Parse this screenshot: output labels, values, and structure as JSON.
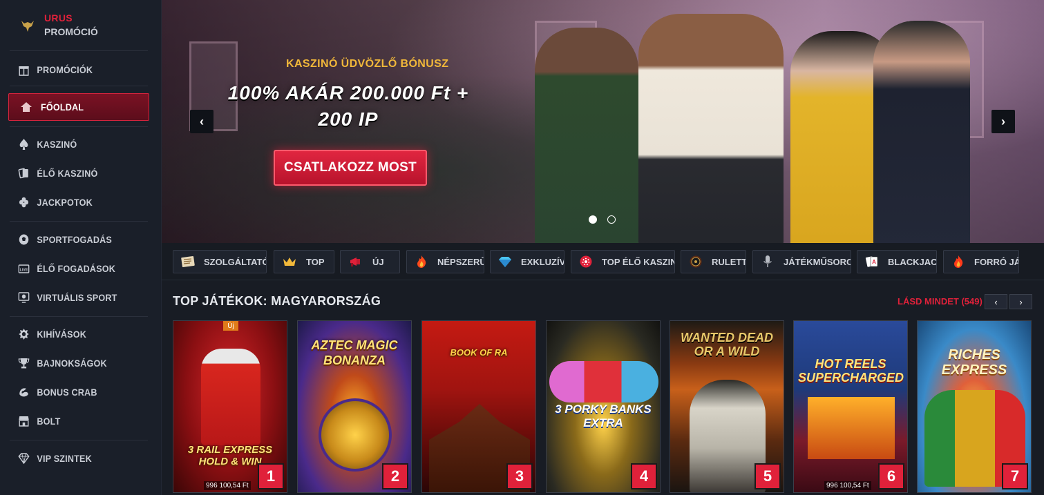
{
  "sidebar": {
    "promo": {
      "line1": "URUS",
      "line2": "PROMÓCIÓ"
    },
    "items": [
      {
        "label": "PROMÓCIÓK",
        "icon": "gift-icon"
      },
      {
        "label": "FŐOLDAL",
        "icon": "home-icon",
        "active": true
      },
      {
        "label": "KASZINÓ",
        "icon": "spade-icon"
      },
      {
        "label": "ÉLŐ KASZINÓ",
        "icon": "live-cards-icon"
      },
      {
        "label": "JACKPOTOK",
        "icon": "clover-icon"
      },
      {
        "label": "SPORTFOGADÁS",
        "icon": "soccer-ball-icon"
      },
      {
        "label": "ÉLŐ FOGADÁSOK",
        "icon": "live-tv-icon"
      },
      {
        "label": "VIRTUÁLIS SPORT",
        "icon": "monitor-ball-icon"
      },
      {
        "label": "KIHÍVÁSOK",
        "icon": "badge-icon"
      },
      {
        "label": "BAJNOKSÁGOK",
        "icon": "trophy-icon"
      },
      {
        "label": "BONUS CRAB",
        "icon": "crab-claw-icon"
      },
      {
        "label": "BOLT",
        "icon": "shop-icon"
      },
      {
        "label": "VIP SZINTEK",
        "icon": "diamond-icon"
      }
    ]
  },
  "banner": {
    "subtitle": "KASZINÓ ÜDVÖZLŐ BÓNUSZ",
    "headline_line1": "100% AKÁR 200.000 Ft +",
    "headline_line2": "200 IP",
    "cta": "CSATLAKOZZ MOST",
    "prev": "‹",
    "next": "›",
    "slides_total": 2,
    "slide_active": 1
  },
  "categories": [
    {
      "label": "SZOLGÁLTATÓK",
      "icon": "provider-icon"
    },
    {
      "label": "TOP",
      "icon": "crown-icon"
    },
    {
      "label": "ÚJ",
      "icon": "megaphone-icon"
    },
    {
      "label": "NÉPSZERŰ",
      "icon": "fire-icon"
    },
    {
      "label": "EXKLUZÍV",
      "icon": "gem-icon"
    },
    {
      "label": "TOP ÉLŐ KASZINÓ",
      "icon": "chip-icon"
    },
    {
      "label": "RULETT",
      "icon": "roulette-icon"
    },
    {
      "label": "JÁTÉKMŰSOROK",
      "icon": "microphone-icon"
    },
    {
      "label": "BLACKJACK",
      "icon": "cards-icon"
    },
    {
      "label": "FORRÓ JÁTÉKOK",
      "icon": "hot-fire-icon"
    }
  ],
  "top_games": {
    "title": "TOP JÁTÉKOK: MAGYARORSZÁG",
    "see_all": "LÁSD MINDET (549)",
    "games": [
      {
        "rank": "1",
        "title": "3 RAIL EXPRESS HOLD & WIN",
        "badge": "Új",
        "price": "996 100,54 Ft",
        "bg": "#7a1010"
      },
      {
        "rank": "2",
        "title": "AZTEC MAGIC BONANZA",
        "badge": "",
        "price": "",
        "bg": "#3a2a7a"
      },
      {
        "rank": "3",
        "title": "BOOK OF RA",
        "badge": "",
        "price": "",
        "bg": "#8a1a10"
      },
      {
        "rank": "4",
        "title": "3 PORKY BANKS EXTRA",
        "badge": "",
        "price": "",
        "bg": "#2a2a2a"
      },
      {
        "rank": "5",
        "title": "WANTED DEAD OR A WILD",
        "badge": "",
        "price": "",
        "bg": "#5a2a14"
      },
      {
        "rank": "6",
        "title": "HOT REELS SUPERCHARGED",
        "badge": "",
        "price": "996 100,54 Ft",
        "bg": "#1e3a7a"
      },
      {
        "rank": "7",
        "title": "RICHES EXPRESS",
        "badge": "",
        "price": "",
        "bg": "#2a7ab0"
      }
    ]
  },
  "colors": {
    "accent": "#e0213a",
    "gold": "#f1b83a",
    "bg": "#181c24"
  }
}
